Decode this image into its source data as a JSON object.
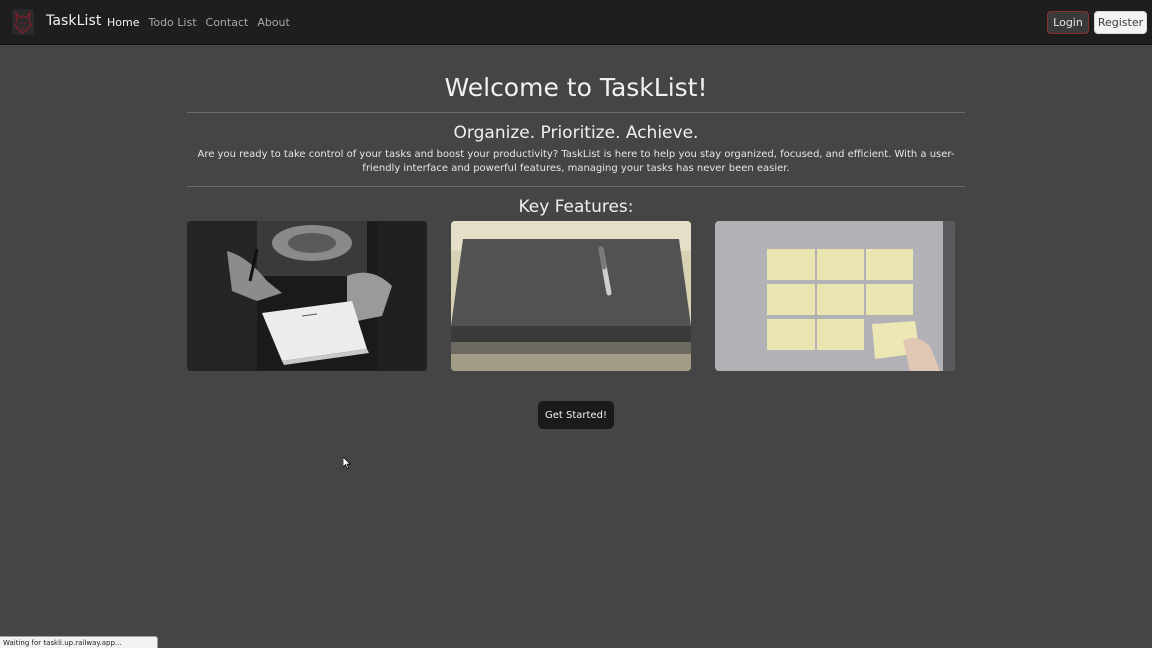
{
  "navbar": {
    "logo_icon": "wolf-logo-icon",
    "brand": "TaskList",
    "links": [
      "Home",
      "Todo List",
      "Contact",
      "About"
    ],
    "active_link": "Home",
    "login_label": "Login",
    "register_label": "Register"
  },
  "hero": {
    "title": "Welcome to TaskList!",
    "subtitle": "Organize. Prioritize. Achieve.",
    "intro": "Are you ready to take control of your tasks and boost your productivity? TaskList is here to help you stay organized, focused, and efficient. With a user-friendly interface and powerful features, managing your tasks has never been easier."
  },
  "features": {
    "heading": "Key Features:",
    "images": [
      "writing-notes-photo",
      "pen-on-notebook-photo",
      "sticky-notes-photo"
    ]
  },
  "cta": {
    "label": "Get Started!"
  },
  "status_bar": {
    "text": "Waiting for taskli.up.railway.app..."
  },
  "colors": {
    "navbar_bg": "#1e1e1e",
    "page_bg": "#454545",
    "login_border": "#8b2d36",
    "cta_bg": "#1a1a1a"
  }
}
